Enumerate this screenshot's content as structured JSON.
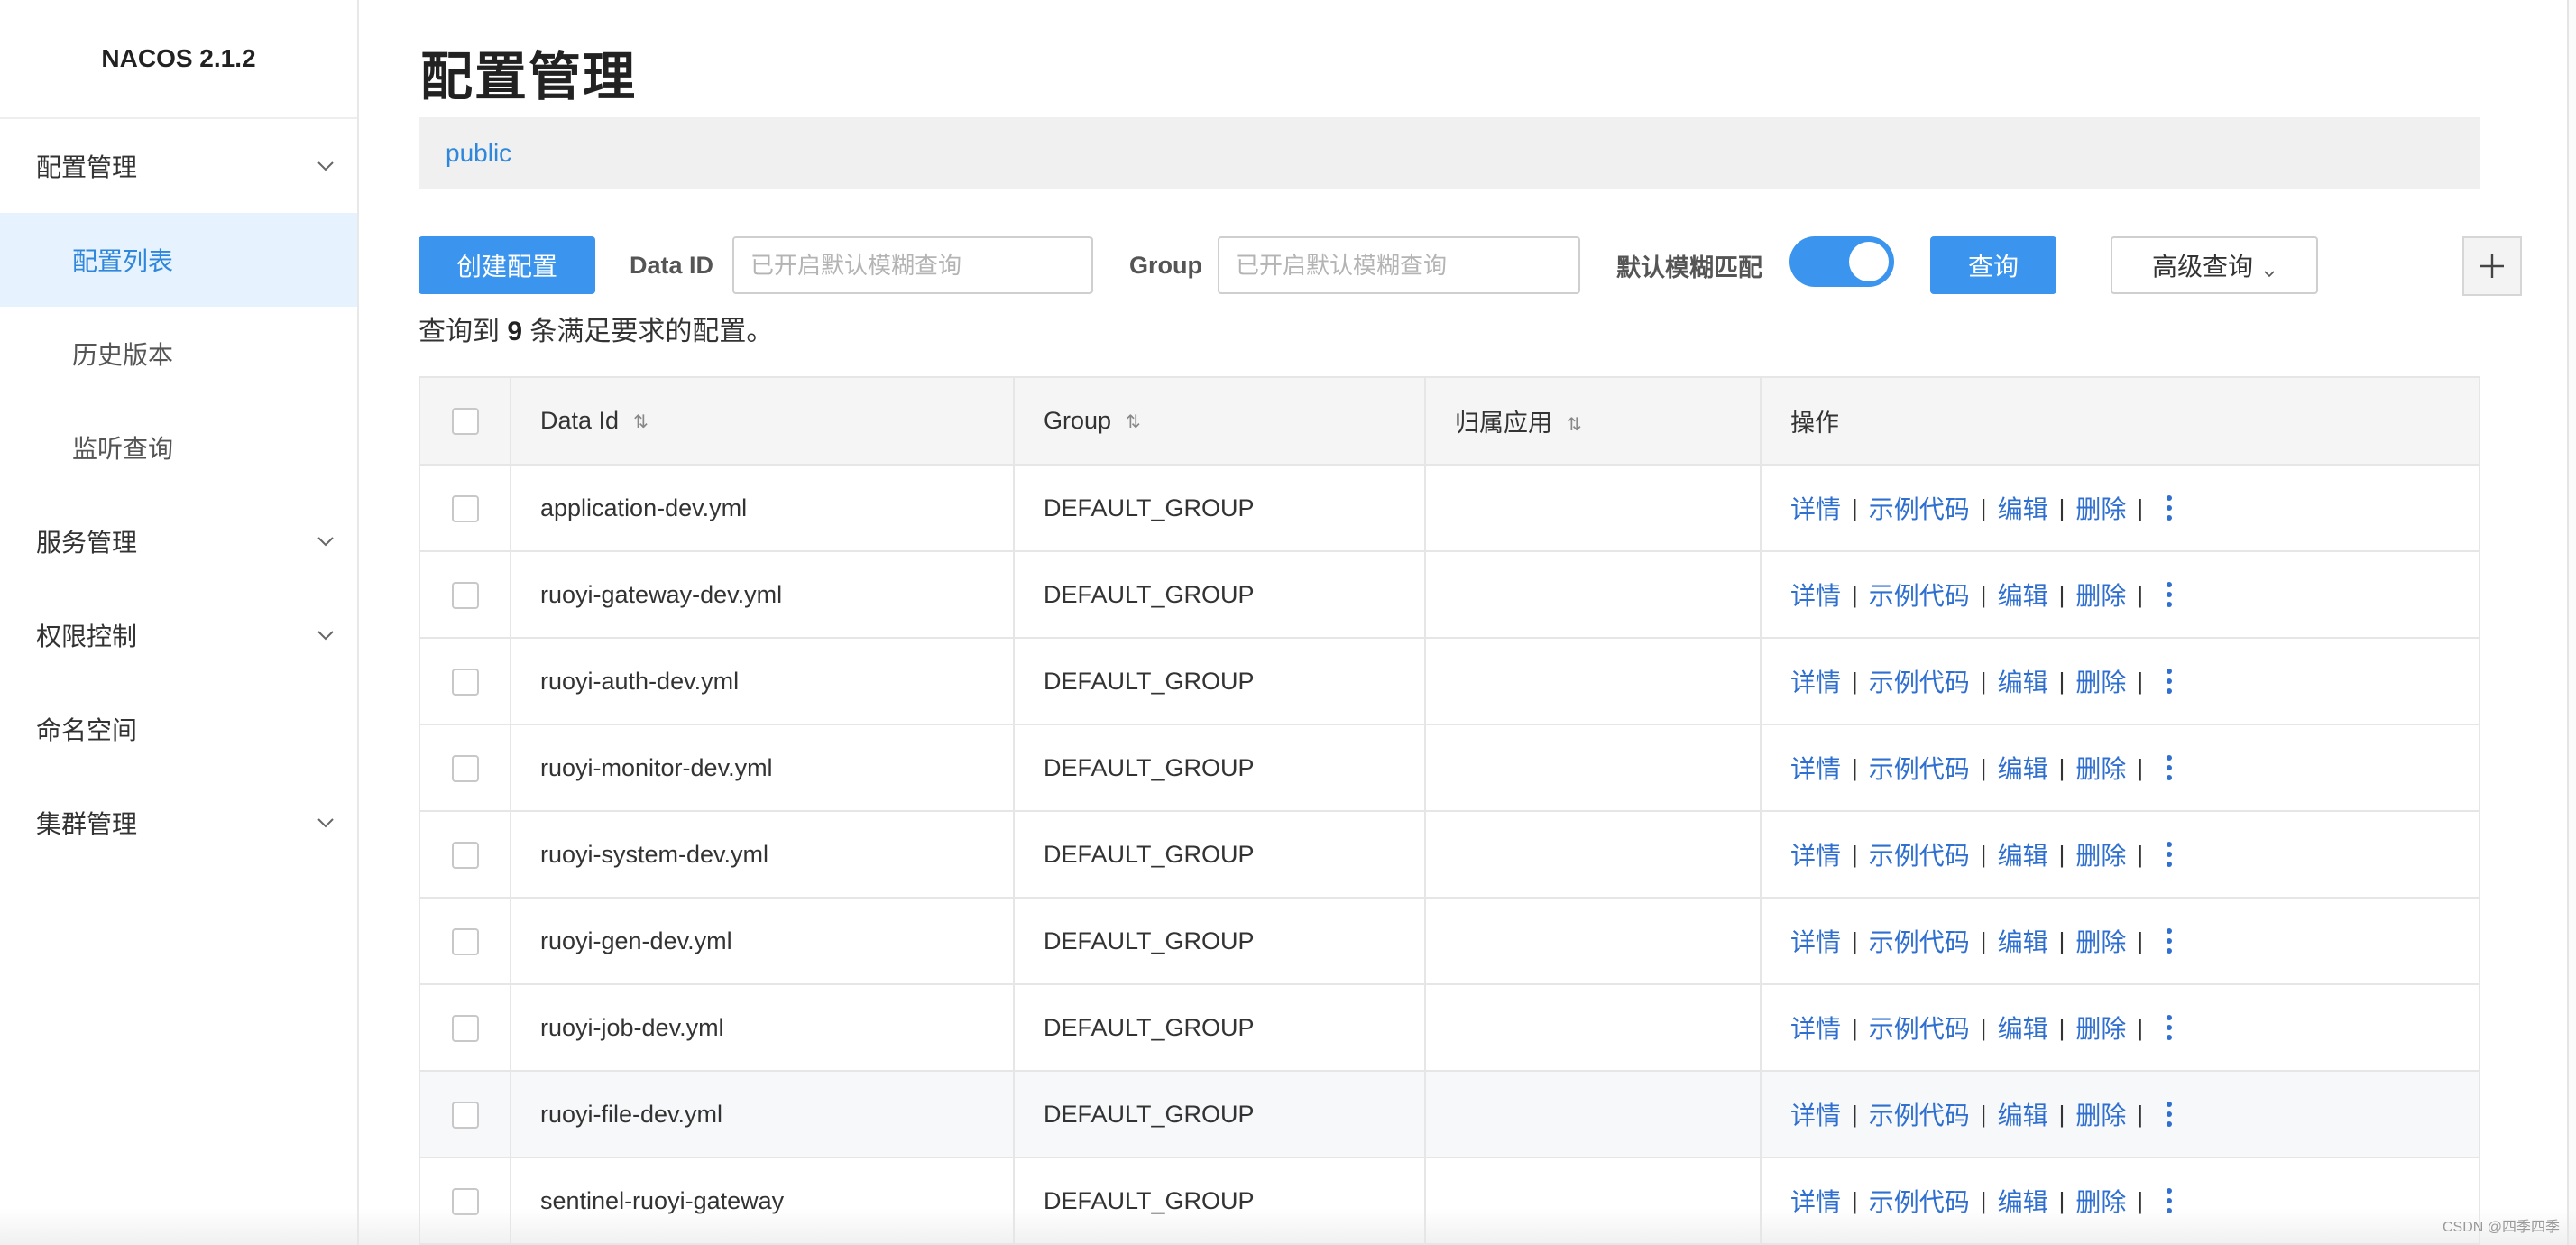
{
  "brand": "NACOS 2.1.2",
  "sidebar": {
    "items": [
      {
        "label": "配置管理",
        "expandable": true
      },
      {
        "label": "配置列表",
        "sub": true,
        "active": true
      },
      {
        "label": "历史版本",
        "sub": true
      },
      {
        "label": "监听查询",
        "sub": true
      },
      {
        "label": "服务管理",
        "expandable": true
      },
      {
        "label": "权限控制",
        "expandable": true
      },
      {
        "label": "命名空间"
      },
      {
        "label": "集群管理",
        "expandable": true
      }
    ]
  },
  "page": {
    "title": "配置管理",
    "namespace": "public"
  },
  "toolbar": {
    "create_label": "创建配置",
    "dataid_label": "Data ID",
    "dataid_placeholder": "已开启默认模糊查询",
    "group_label": "Group",
    "group_placeholder": "已开启默认模糊查询",
    "fuzzy_label": "默认模糊匹配",
    "fuzzy_on": true,
    "search_label": "查询",
    "advanced_label": "高级查询"
  },
  "result": {
    "prefix": "查询到",
    "count": "9",
    "suffix": "条满足要求的配置。"
  },
  "table": {
    "headers": {
      "data_id": "Data Id",
      "group": "Group",
      "app": "归属应用",
      "ops": "操作"
    },
    "rows": [
      {
        "data_id": "application-dev.yml",
        "group": "DEFAULT_GROUP",
        "app": ""
      },
      {
        "data_id": "ruoyi-gateway-dev.yml",
        "group": "DEFAULT_GROUP",
        "app": ""
      },
      {
        "data_id": "ruoyi-auth-dev.yml",
        "group": "DEFAULT_GROUP",
        "app": ""
      },
      {
        "data_id": "ruoyi-monitor-dev.yml",
        "group": "DEFAULT_GROUP",
        "app": ""
      },
      {
        "data_id": "ruoyi-system-dev.yml",
        "group": "DEFAULT_GROUP",
        "app": ""
      },
      {
        "data_id": "ruoyi-gen-dev.yml",
        "group": "DEFAULT_GROUP",
        "app": ""
      },
      {
        "data_id": "ruoyi-job-dev.yml",
        "group": "DEFAULT_GROUP",
        "app": ""
      },
      {
        "data_id": "ruoyi-file-dev.yml",
        "group": "DEFAULT_GROUP",
        "app": "",
        "highlight": true
      },
      {
        "data_id": "sentinel-ruoyi-gateway",
        "group": "DEFAULT_GROUP",
        "app": ""
      }
    ],
    "ops": {
      "detail": "详情",
      "sample": "示例代码",
      "edit": "编辑",
      "delete": "删除",
      "sep": "|"
    }
  },
  "watermark": "CSDN @四季四季"
}
